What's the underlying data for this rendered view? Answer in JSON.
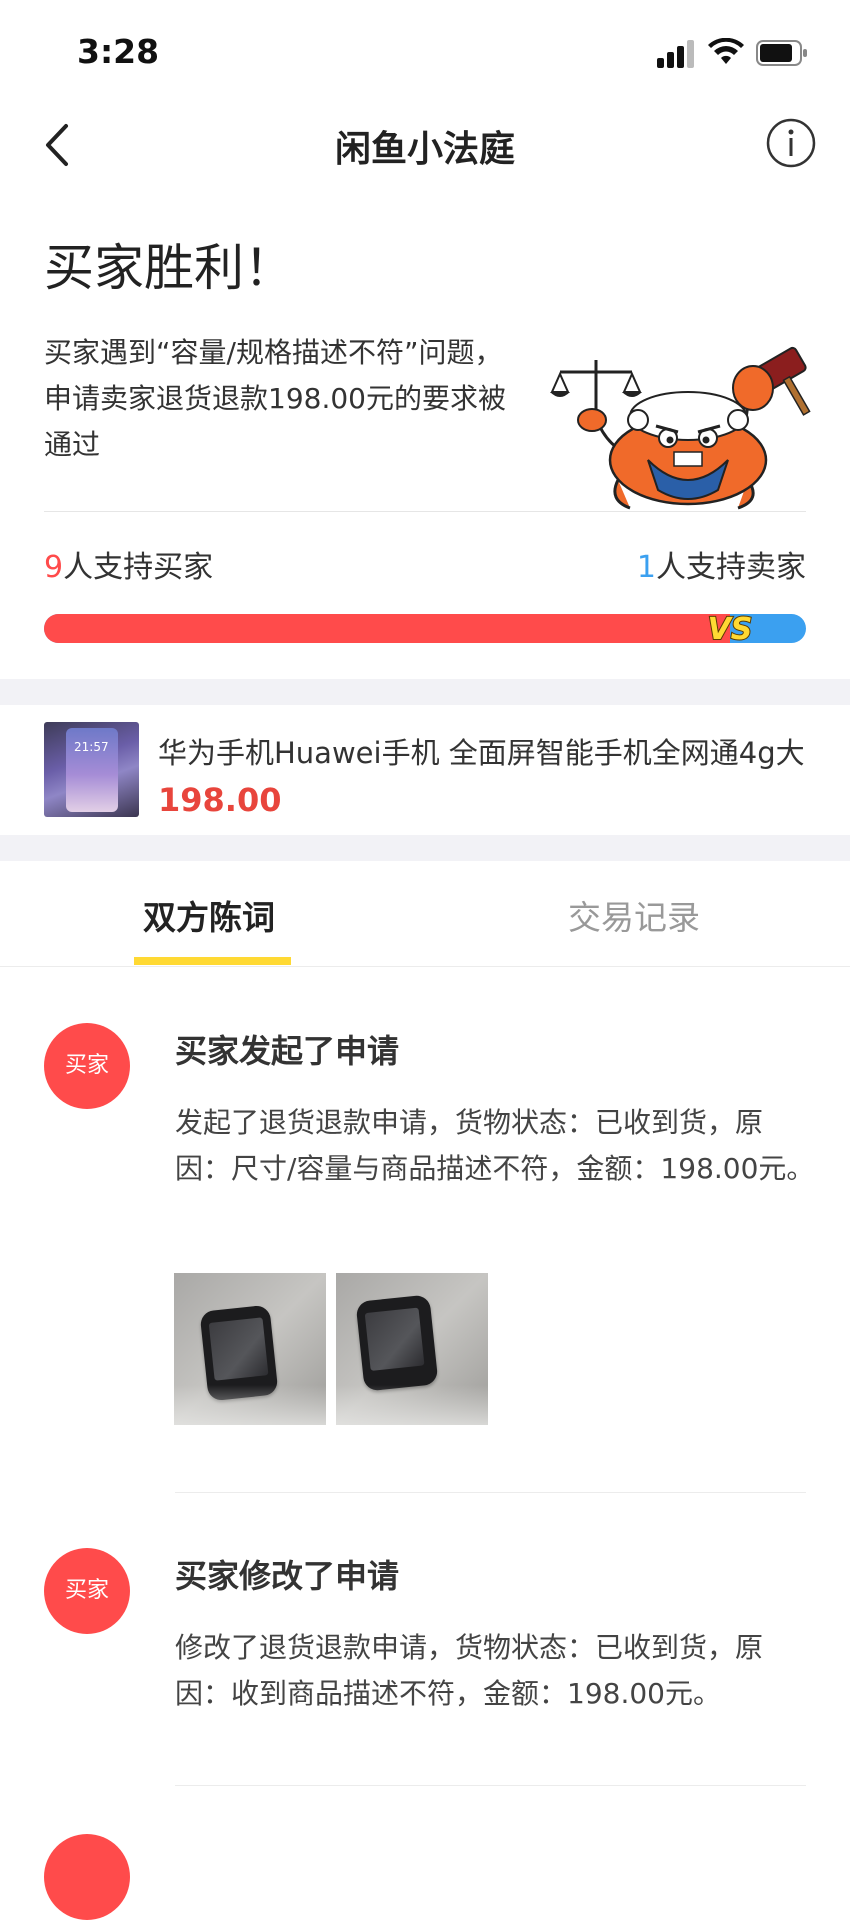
{
  "status_bar": {
    "time": "3:28"
  },
  "nav": {
    "title": "闲鱼小法庭"
  },
  "verdict": {
    "title": "买家胜利！",
    "description": "买家遇到“容量/规格描述不符”问题，申请卖家退货退款198.00元的要求被通过"
  },
  "support": {
    "buyer_count": "9",
    "buyer_label": "人支持买家",
    "seller_count": "1",
    "seller_label": "人支持卖家",
    "buyer_fraction": 0.9,
    "vs_label": "VS"
  },
  "product": {
    "name": "华为手机Huawei手机 全面屏智能手机全网通4g大",
    "price": "198.00",
    "thumb_clock": "21:57"
  },
  "tabs": [
    {
      "label": "双方陈词",
      "active": true
    },
    {
      "label": "交易记录",
      "active": false
    }
  ],
  "events": [
    {
      "badge": "买家",
      "title": "买家发起了申请",
      "description": "发起了退货退款申请，货物状态：已收到货，原因：尺寸/容量与商品描述不符，金额：198.00元。",
      "photos": 2
    },
    {
      "badge": "买家",
      "title": "买家修改了申请",
      "description": "修改了退货退款申请，货物状态：已收到货，原因：收到商品描述不符，金额：198.00元。"
    }
  ],
  "colors": {
    "buyer": "#ff4b4b",
    "seller": "#3ba0f0",
    "price": "#e8453c",
    "tab_indicator": "#ffd933"
  },
  "icons": {
    "back": "chevron-left-icon",
    "info": "info-circle-icon",
    "signal": "cellular-signal-icon",
    "wifi": "wifi-icon",
    "battery": "battery-icon"
  }
}
